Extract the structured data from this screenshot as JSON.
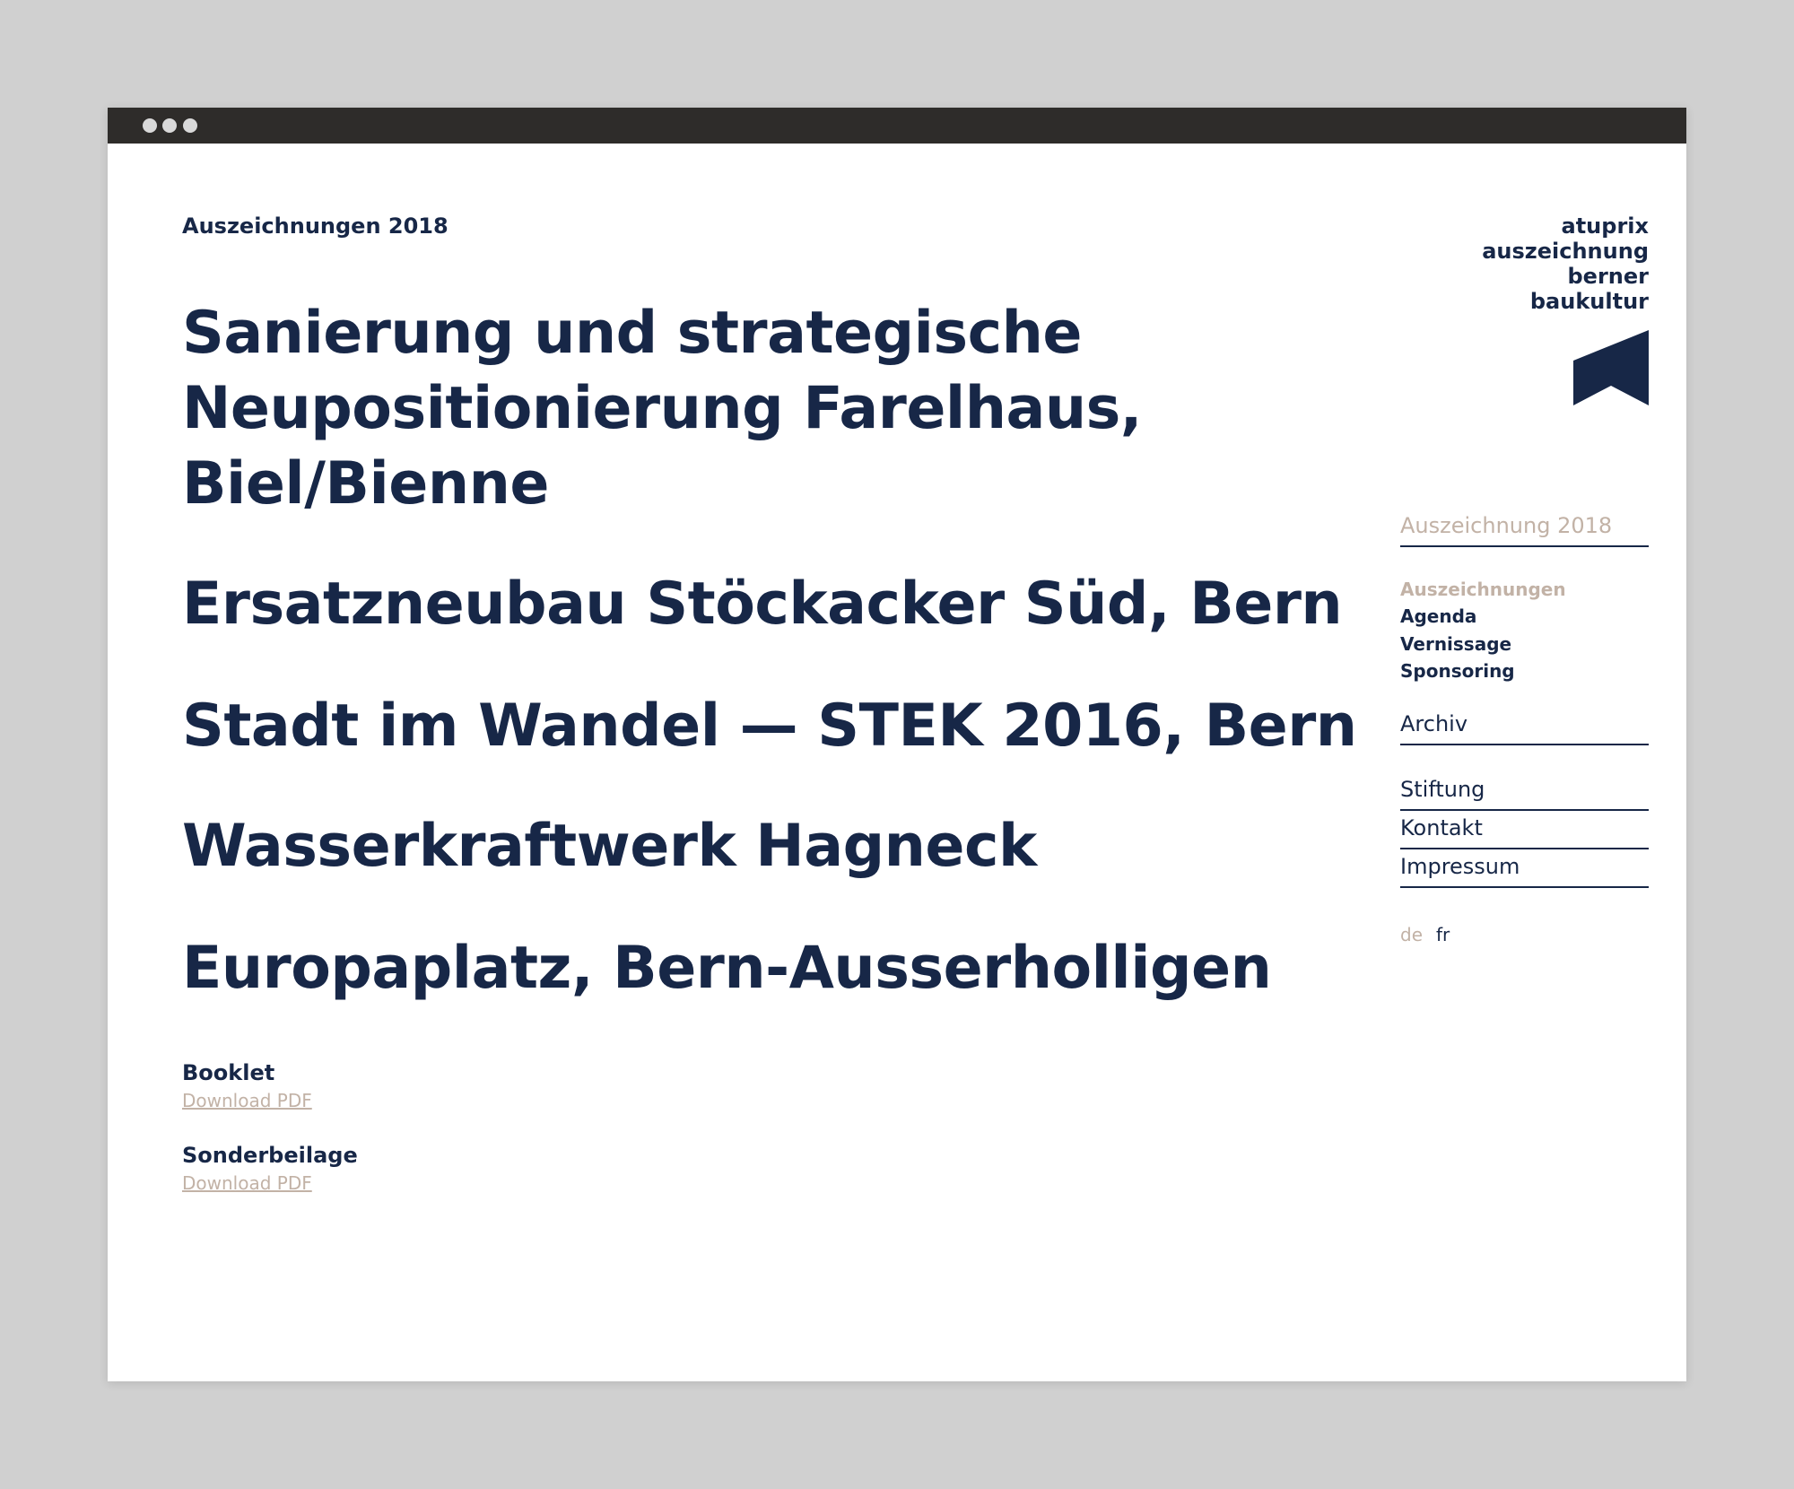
{
  "page": {
    "kicker": "Auszeichnungen 2018",
    "projects": [
      {
        "lines": [
          "Sanierung und strategische",
          "Neupositionierung Farelhaus,",
          "Biel/Bienne"
        ]
      },
      {
        "lines": [
          "Ersatzneubau Stöckacker Süd, Bern"
        ]
      },
      {
        "lines": [
          "Stadt im Wandel — STEK 2016, Bern"
        ]
      },
      {
        "lines": [
          "Wasserkraftwerk Hagneck"
        ]
      },
      {
        "lines": [
          "Europaplatz, Bern-Ausserholligen"
        ]
      }
    ],
    "downloads": [
      {
        "label": "Booklet",
        "link": "Download PDF"
      },
      {
        "label": "Sonderbeilage",
        "link": "Download PDF"
      }
    ]
  },
  "logo": {
    "lines": [
      "atuprix",
      "auszeichnung",
      "berner",
      "baukultur"
    ],
    "icon": "flag-mark-icon",
    "color": "#172747"
  },
  "nav": {
    "section_title": "Auszeichnung 2018",
    "sub_items": [
      {
        "label": "Auszeichnungen",
        "active": true
      },
      {
        "label": "Agenda",
        "active": false
      },
      {
        "label": "Vernissage",
        "active": false
      },
      {
        "label": "Sponsoring",
        "active": false
      }
    ],
    "archive": "Archiv",
    "footer_items": [
      "Stiftung",
      "Kontakt",
      "Impressum"
    ],
    "languages": [
      {
        "label": "de",
        "active": true
      },
      {
        "label": "fr",
        "active": false
      }
    ]
  },
  "colors": {
    "text": "#172747",
    "muted": "#c2b2a6",
    "titlebar": "#2e2c2a",
    "background": "#d0d0d0",
    "window": "#ffffff"
  }
}
